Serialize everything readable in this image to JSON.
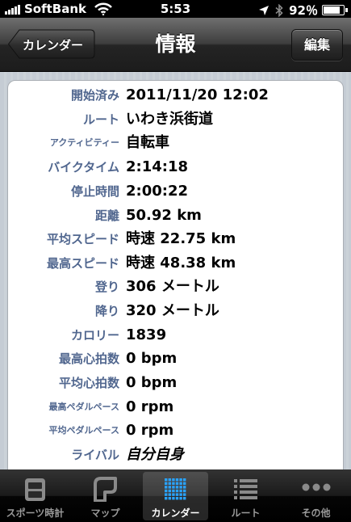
{
  "status_bar": {
    "carrier": "SoftBank",
    "time": "5:53",
    "battery": "92％",
    "battery_level": 0.92
  },
  "nav": {
    "back_label": "カレンダー",
    "title": "情報",
    "edit_label": "編集"
  },
  "details": [
    {
      "label": "開始済み",
      "value": "2011/11/20 12:02"
    },
    {
      "label": "ルート",
      "value": "いわき浜街道"
    },
    {
      "label": "アクティビティー",
      "value": "自転車"
    },
    {
      "label": "バイクタイム",
      "value": "2:14:18"
    },
    {
      "label": "停止時間",
      "value": "2:00:22"
    },
    {
      "label": "距離",
      "value": "50.92 km"
    },
    {
      "label": "平均スピード",
      "value": "時速 22.75 km"
    },
    {
      "label": "最高スピード",
      "value": "時速 48.38 km"
    },
    {
      "label": "登り",
      "value": "306 メートル"
    },
    {
      "label": "降り",
      "value": "320 メートル"
    },
    {
      "label": "カロリー",
      "value": "1839"
    },
    {
      "label": "最高心拍数",
      "value": "0 bpm"
    },
    {
      "label": "平均心拍数",
      "value": "0 bpm"
    },
    {
      "label": "最高ペダルペース",
      "value": "0 rpm"
    },
    {
      "label": "平均ペダルペース",
      "value": "0 rpm"
    },
    {
      "label": "ライバル",
      "value": "自分自身"
    }
  ],
  "tabs": [
    {
      "label": "スポーツ時計",
      "icon": "stopwatch-icon"
    },
    {
      "label": "マップ",
      "icon": "map-icon"
    },
    {
      "label": "カレンダー",
      "icon": "calendar-icon",
      "selected": true
    },
    {
      "label": "ルート",
      "icon": "list-icon"
    },
    {
      "label": "その他",
      "icon": "more-icon"
    }
  ],
  "colors": {
    "label_blue": "#51678f",
    "navbar": "#2a2a2a",
    "background": "#c5ccd4"
  }
}
